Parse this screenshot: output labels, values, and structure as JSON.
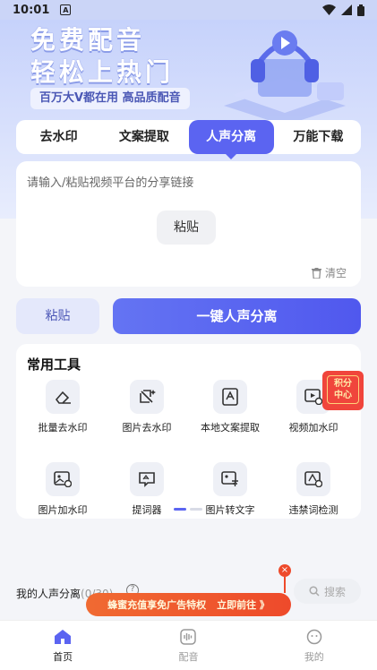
{
  "status_bar": {
    "time": "10:01",
    "indicator": "A"
  },
  "hero": {
    "title_line1": "免费配音",
    "title_line2": "轻松上热门",
    "subtitle": "百万大V都在用 高品质配音"
  },
  "tabs": [
    {
      "label": "去水印"
    },
    {
      "label": "文案提取"
    },
    {
      "label": "人声分离",
      "active": true
    },
    {
      "label": "万能下载"
    }
  ],
  "input": {
    "placeholder": "请输入/粘贴视频平台的分享链接",
    "paste_label": "粘贴",
    "clear_label": "清空"
  },
  "actions": {
    "paste_label": "粘贴",
    "primary_label": "一键人声分离"
  },
  "tools": {
    "title": "常用工具",
    "items": [
      {
        "label": "批量去水印",
        "icon": "eraser-icon"
      },
      {
        "label": "图片去水印",
        "icon": "image-sparkle-icon"
      },
      {
        "label": "本地文案提取",
        "icon": "text-extract-icon"
      },
      {
        "label": "视频加水印",
        "icon": "video-watermark-icon"
      },
      {
        "label": "图片加水印",
        "icon": "image-add-icon"
      },
      {
        "label": "提词器",
        "icon": "teleprompter-icon"
      },
      {
        "label": "图片转文字",
        "icon": "image-text-icon"
      },
      {
        "label": "违禁词检测",
        "icon": "text-check-icon"
      }
    ]
  },
  "float_badge": {
    "line1": "积分",
    "line2": "中心"
  },
  "history": {
    "title": "我的人声分离",
    "count": "(0/30)"
  },
  "search": {
    "label": "搜索"
  },
  "promo": {
    "text": "蜂蜜充值享免广告特权",
    "cta": "立即前往 》"
  },
  "bottom_nav": [
    {
      "label": "首页",
      "icon": "home-icon",
      "active": true
    },
    {
      "label": "配音",
      "icon": "audio-wave-icon"
    },
    {
      "label": "我的",
      "icon": "profile-icon"
    }
  ],
  "colors": {
    "accent": "#5b64f1",
    "promo": "#ee4a2b",
    "badge": "#f0453c"
  }
}
